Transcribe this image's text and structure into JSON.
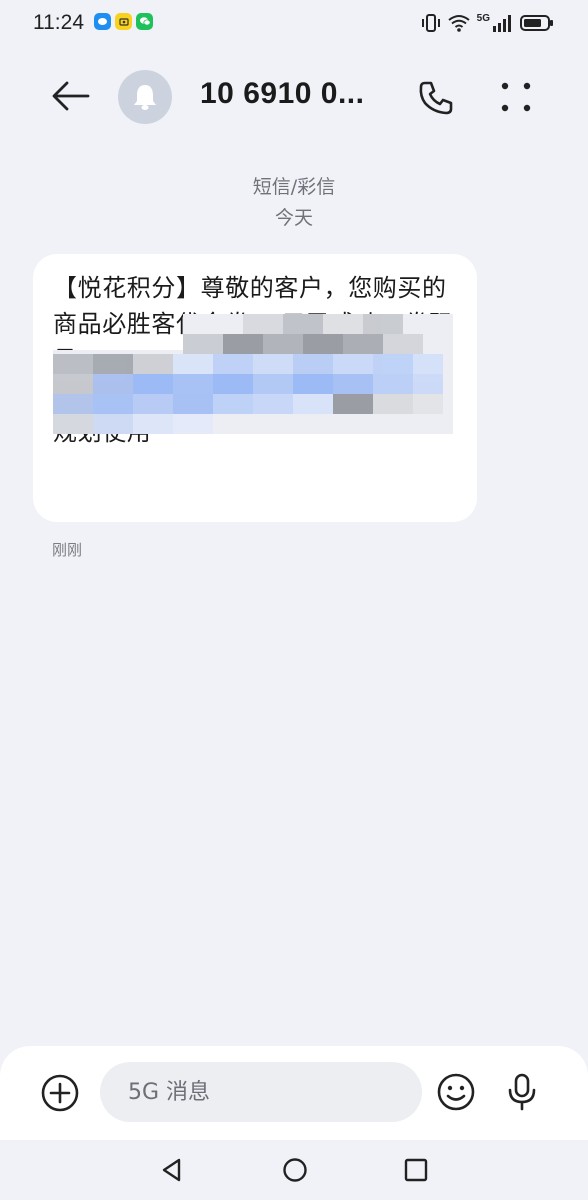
{
  "status_bar": {
    "time": "11:24",
    "notification_icons": [
      "message-app-icon",
      "bank-app-icon",
      "wechat-icon"
    ],
    "system_icons": [
      "vibrate-icon",
      "wifi-icon",
      "5g-signal-icon",
      "battery-icon"
    ],
    "network_label": "5G"
  },
  "header": {
    "contact_name": "10 6910 0...",
    "avatar_icon": "bell-icon",
    "back_icon": "back-arrow-icon",
    "call_icon": "phone-icon",
    "more_icon": "more-dots-icon"
  },
  "thread": {
    "type_label": "短信/彩信",
    "date_label": "今天"
  },
  "message": {
    "text": "【悦花积分】尊敬的客户，您购买的商品必胜客代金券50元已成功，券码号：　　　　　　　　安全保护　　　　　　　　　　　　　　　　　直接有效期30天，请在有效期内合理规划使用",
    "time": "刚刚",
    "redacted": true
  },
  "composer": {
    "placeholder": "5G 消息",
    "value": ""
  },
  "colors": {
    "background": "#f1f2f7",
    "bubble": "#ffffff",
    "avatar": "#cdd3de",
    "blur_blue": "#8fb3f7",
    "blur_gray": "#8d9097"
  }
}
